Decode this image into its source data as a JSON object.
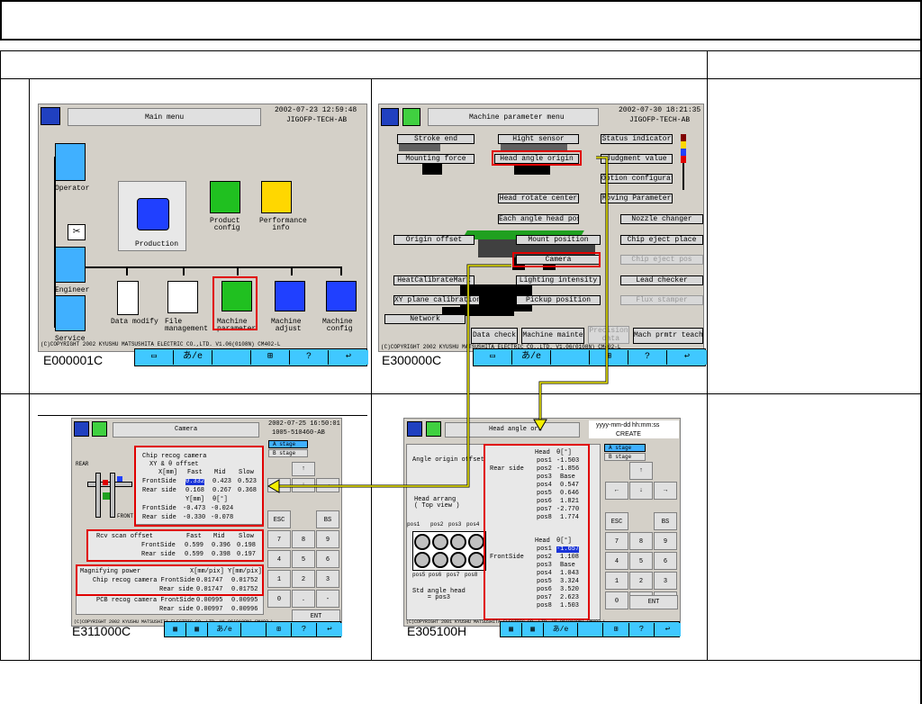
{
  "cells": {
    "top_left": {
      "main_menu_screen": {
        "title": "Main menu",
        "datetime": "2002-07-23   12:59:48",
        "program": "JIGOFP-TECH-AB",
        "items": {
          "operator": "Operator",
          "engineer": "Engineer",
          "service": "Service",
          "production": "Production",
          "product_config": "Product\n config",
          "performance": "Performance\n   info",
          "data_modify": "Data modify",
          "file_management": "File\nmanagement",
          "machine_parameter": "Machine\nparameter",
          "machine_adjust": "Machine\n adjust",
          "machine_config": "Machine\n config"
        },
        "copyright": "(C)COPYRIGHT 2002 KYUSHU MATSUSHITA ELECTRIC CO.,LTD. V1.06(0108N)  CM402-L",
        "screen_id": "E000001C"
      }
    },
    "top_right": {
      "machine_parameter_screen": {
        "title": "Machine parameter menu",
        "datetime": "2002-07-30  18:21:35",
        "program": "JIGOFP-TECH-AB",
        "buttons": {
          "stroke_end": "Stroke end",
          "hight_sensor": "Hight sensor",
          "status_indicator": "Status indicator",
          "mounting_force": "Mounting force",
          "head_angle_origin": "Head angle origin",
          "judgment_value": "Judgment value",
          "option_config": "Option configurat",
          "head_rotate_center": "Head rotate center",
          "moving_parameter": "Moving Parameter",
          "each_angle_head_pos": "Each angle head pos",
          "nozzle_changer": "Nozzle changer",
          "origin_offset": "Origin offset",
          "mount_position": "Mount position",
          "chip_eject_place": "Chip eject place",
          "camera": "Camera",
          "chip_eject_pos": "Chip eject pos",
          "head_calibrate_mark": "HeatCalibrateMark",
          "lighting_intensity": "Lighting intensity",
          "lead_checker": "Lead checker",
          "xy_plane_calibration": "XY plane calibration",
          "pickup_position": "Pickup position",
          "flux_stamper": "Flux stamper",
          "network": "Network",
          "data_check": "Data check",
          "machine_mainte": "Machine mainte",
          "precision_data": "Precision\n data",
          "mach_prmtr_teach": "Mach prmtr teach"
        },
        "copyright": "(C)COPYRIGHT 2002 KYUSHU MATSUSHITA ELECTRIC CO.,LTD. V1.06(0108N)  CM402-L",
        "screen_id": "E300000C"
      }
    },
    "bottom_left": {
      "camera_screen": {
        "title": "Camera",
        "datetime": "2002-07-25  16:50:01",
        "program": "1005-510460-AB",
        "a_stage": "A stage",
        "b_stage": "B stage",
        "rear": "REAR",
        "front": "FRONT",
        "chip_recog_camera": "Chip recog camera",
        "xy_offset": "XY & θ offset",
        "units_x": "X[mm]",
        "units_y": "Y[mm]",
        "units_theta": "θ[°]",
        "fast": "Fast",
        "mid": "Mid",
        "slow": "Slow",
        "front_side": "FrontSide",
        "rear_side": "Rear side",
        "x_front": [
          "0.332",
          "0.423",
          "0.523"
        ],
        "x_rear": [
          "0.168",
          "0.267",
          "0.368"
        ],
        "y_front": [
          "-0.473",
          "-0.024"
        ],
        "y_rear": [
          "-0.330",
          "-0.078"
        ],
        "rcv_scan_offset": "Rcv scan offset",
        "rcv_front": [
          "0.599",
          "0.396",
          "0.198"
        ],
        "rcv_rear": [
          "0.599",
          "0.398",
          "0.197"
        ],
        "magnifying_power": "Magnifying power",
        "xmm_pix": "X[mm/pix]",
        "ymm_pix": "Y[mm/pix]",
        "chip_recog_camera_front": "Chip recog camera FrontSide",
        "mag_chip_front": [
          "0.01747",
          "0.01752"
        ],
        "mag_chip_rear": [
          "0.01747",
          "0.01752"
        ],
        "pcb_recog_camera_front": "PCB recog camera FrontSide",
        "mag_pcb_front": [
          "0.00995",
          "0.00995"
        ],
        "mag_pcb_rear": [
          "0.00997",
          "0.00996"
        ],
        "keys": [
          "ESC",
          "BS",
          "7",
          "8",
          "9",
          "4",
          "5",
          "6",
          "1",
          "2",
          "3",
          "0",
          ".",
          "-",
          "ENT"
        ],
        "copyright": "(C)COPYRIGHT 2002 KYUSHU MATSUSHITA ELECTRIC CO.,LTD. V1.06(0108N)  CM402-L",
        "screen_id": "E311000C"
      }
    },
    "bottom_right": {
      "head_angle_screen": {
        "title": "Head angle ori",
        "datetime": "yyyy-mm-dd  hh:mm:ss",
        "program": "CREATE",
        "a_stage": "A stage",
        "b_stage": "B stage",
        "angle_origin_offset": "Angle origin offset",
        "head_arrang": "Head arrang\n( Top view )",
        "std_angle_head": "Std angle head\n    = pos3",
        "rear_side": "Rear side",
        "front_side": "FrontSide",
        "head": "Head",
        "theta": "θ[°]",
        "pos_labels": [
          "pos1",
          "pos2",
          "pos3",
          "pos4",
          "pos5",
          "pos6",
          "pos7",
          "pos8"
        ],
        "pos_tags": [
          "pos1",
          "pos2",
          "pos3",
          "pos4",
          "pos5",
          "pos6",
          "pos7",
          "pos8"
        ],
        "rear_values": [
          "-1.503",
          "-1.856",
          "Base",
          "0.547",
          "0.646",
          "1.821",
          "-2.770",
          "1.774"
        ],
        "front_values": [
          "-1.657",
          "1.108",
          "Base",
          "1.043",
          "3.324",
          "3.520",
          "2.623",
          "1.503"
        ],
        "keys": [
          "ESC",
          "BS",
          "7",
          "8",
          "9",
          "4",
          "5",
          "6",
          "1",
          "2",
          "3",
          "0",
          ".",
          "-",
          "ENT"
        ],
        "copyright": "(C)COPYRIGHT 2001 KYUSHU MATSUSHITA ELECTRIC CO.,LTD. V1.06(0108N)  CM402-L",
        "screen_id": "E305100H"
      }
    }
  }
}
